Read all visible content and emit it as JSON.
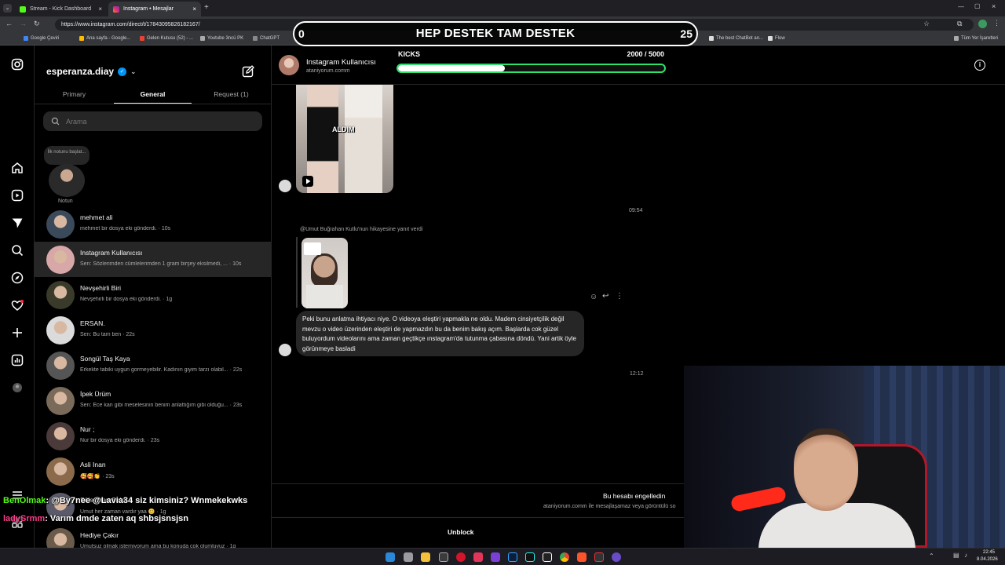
{
  "browser": {
    "tabs": [
      {
        "label": "Stream - Kick Dashboard",
        "color": "#53fc18"
      },
      {
        "label": "Instagram • Mesajlar",
        "color": "#e1306c"
      }
    ],
    "url": "https://www.instagram.com/direct/t/17843095826182167/",
    "bookmarks": [
      {
        "label": "Google Çeviri",
        "color": "#4285f4"
      },
      {
        "label": "Ana sayfa - Google...",
        "color": "#fbbc05"
      },
      {
        "label": "Gelen Kutusu (52) - ...",
        "color": "#ea4335"
      },
      {
        "label": "Youtube 3ncü PK",
        "color": "#888"
      },
      {
        "label": "ChatGPT",
        "color": "#888"
      },
      {
        "label": "Flow",
        "color": "#ddd"
      },
      {
        "label": "The best ChatBot an...",
        "color": "#ddd"
      },
      {
        "label": "Tüm Yer İşaretleri",
        "color": "#888"
      }
    ]
  },
  "instagram": {
    "username": "esperanza.diay",
    "tabs": [
      "Primary",
      "General",
      "Request (1)"
    ],
    "active_tab": "General",
    "search_placeholder": "Arama",
    "note_bubble": "İlk notunu başlat...",
    "note_label": "Notun",
    "conversations": [
      {
        "name": "mehmet ali",
        "preview": "mehmet bir dosya eki gönderdi. · 10s",
        "color": "#3b4a5a"
      },
      {
        "name": "Instagram Kullanıcısı",
        "preview": "Sen: Sözlerimden cümlelerimden 1 gram birşey eksilmedi, ... · 10s",
        "color": "#d8a8a8",
        "selected": true
      },
      {
        "name": "Nevşehirli Biri",
        "preview": "Nevşehirli bir dosya eki gönderdi. · 1g",
        "color": "#3a3a2a"
      },
      {
        "name": "ERSAN.",
        "preview": "Sen: Bu tam ben · 22s",
        "color": "#dbdbdb"
      },
      {
        "name": "Songül Taş Kaya",
        "preview": "Erkekte tabiki uygun gormeyebilir. Kadının giyim tarzı olabil... · 22s",
        "color": "#555"
      },
      {
        "name": "İpek Ürüm",
        "preview": "Sen: Ece kan gibi meselesinin benim anlattığım gibi olduğu... · 23s",
        "color": "#7a6a5a"
      },
      {
        "name": "Nur ;",
        "preview": "Nur bir dosya eki gönderdi. · 23s",
        "color": "#4a3a3a"
      },
      {
        "name": "Asli Inan",
        "preview": "🥰🥰👏 · 23s",
        "color": "#8a6a4a"
      },
      {
        "name": "Süleyman Şahi",
        "preview": "Umut her zaman vardır yaa 😊 · 1g",
        "color": "#5a5a6a"
      },
      {
        "name": "Hediye Çakır",
        "preview": "Umutsuz olmak istemiyorum ama bu konuda çok olumluyuz · 1g",
        "color": "#6a5a4a"
      }
    ],
    "chat": {
      "name": "Instagram Kullanıcısı",
      "handle": "ataniyorum.comm",
      "media_caption": "ALDIM",
      "time_1": "09:54",
      "story_reply_label": "@Umut Buğrahan Kutlu'nun hikayesine yanıt verdi",
      "message": "Peki bunu anlatma ihtiyacı niye. O videoya eleştiri yapmakla ne oldu. Madem cinsiyetçilik değil mevzu o video üzerinden eleştiri de yapmazdın bu da benim bakış açım. Başlarda cok güzel buluyordum videolarını ama zaman geçtikçe ınstagram'da tutunma çabasına döndü. Yani artik öyle görünmeye basladi",
      "time_2": "12:12",
      "blocked_title": "Bu hesabı engelledin",
      "blocked_sub": "ataniyorum.comm ile mesajlaşamaz veya görüntülü so",
      "unblock_label": "Unblock"
    }
  },
  "overlay": {
    "banner_left": "0",
    "banner_text": "HEP DESTEK TAM DESTEK",
    "banner_right": "25",
    "kicks_label": "KICKS",
    "kicks_count": "2000 / 5000",
    "kicks_progress": 0.4,
    "kicks_color": "#2ee36a",
    "chat_lines": [
      {
        "user": "BenOlmak",
        "text": ": @By7nee @Lavia34 siz kimsiniz? Wnmekekwks",
        "color": "#53fc18"
      },
      {
        "user": "ladySrmm",
        "text": ": Varım dmde zaten aq shbsjsnsjsn",
        "color": "#ff3b8a"
      }
    ]
  },
  "taskbar": {
    "time": "22:45",
    "date": "8.04.2026"
  }
}
